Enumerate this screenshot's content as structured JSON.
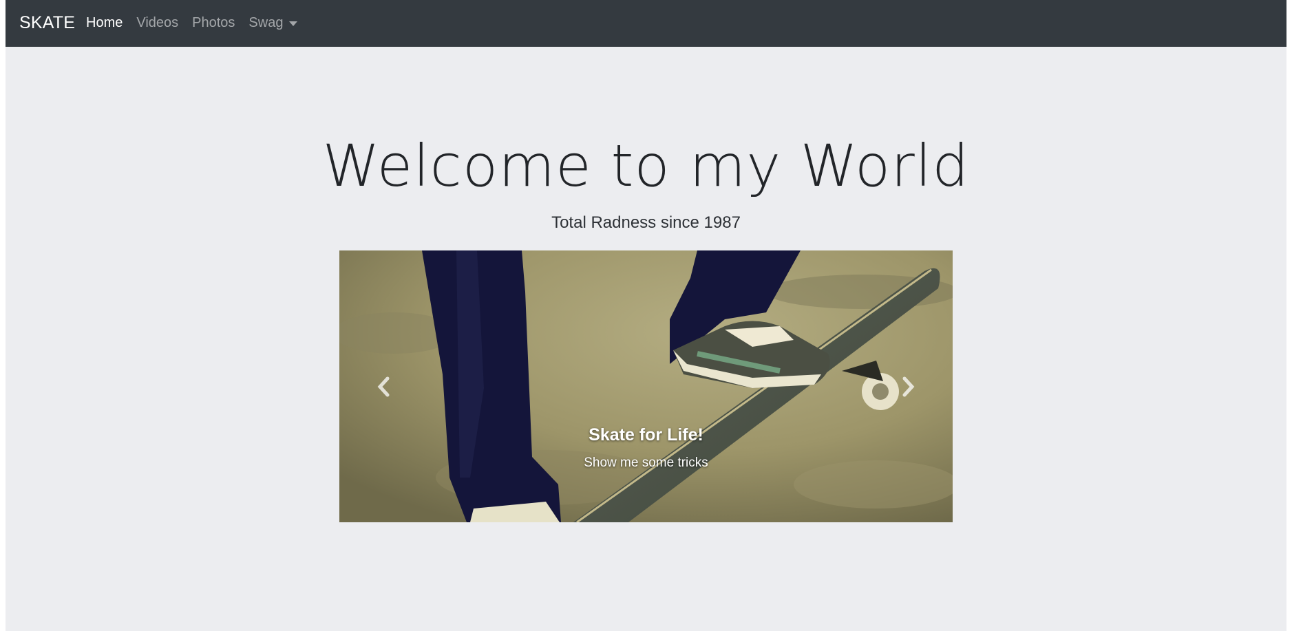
{
  "navbar": {
    "brand": "SKATE",
    "items": [
      {
        "label": "Home",
        "active": true
      },
      {
        "label": "Videos",
        "active": false
      },
      {
        "label": "Photos",
        "active": false
      },
      {
        "label": "Swag",
        "active": false,
        "dropdown": true
      }
    ]
  },
  "hero": {
    "title": "Welcome to my World",
    "subtitle": "Total Radness since 1987"
  },
  "carousel": {
    "slide_caption_title": "Skate for Life!",
    "slide_caption_text": "Show me some tricks",
    "prev_icon": "chevron-left-icon",
    "next_icon": "chevron-right-icon"
  },
  "colors": {
    "navbar_bg": "#343a40",
    "page_bg": "#ecedf0",
    "nav_active": "#ffffff",
    "nav_inactive": "rgba(255,255,255,0.55)"
  }
}
